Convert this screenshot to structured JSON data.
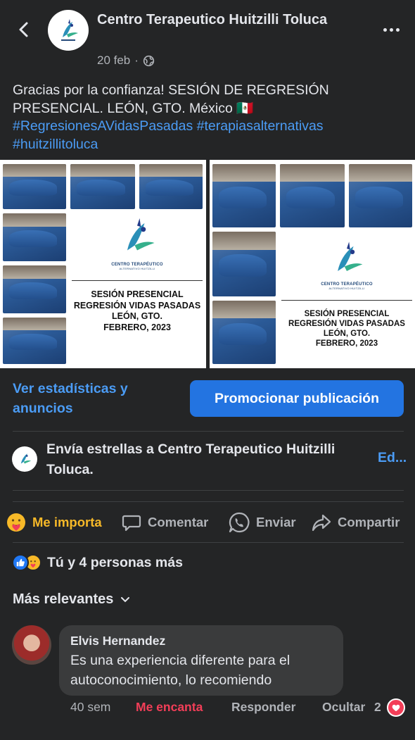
{
  "header": {
    "page_name": "Centro Terapeutico Huitzilli Toluca",
    "date": "20 feb",
    "separator": "·",
    "audience_icon": "globe-icon"
  },
  "post": {
    "caption_text": "Gracias por la confianza! SESIÓN DE REGRESIÓN PRESENCIAL. LEÓN, GTO. México 🇲🇽",
    "hashtags": [
      "#RegresionesAVidasPasadas",
      "#terapiasalternativas",
      "#huitzillitoluca"
    ],
    "images": [
      {
        "logo_text": "CENTRO TERAPÉUTICO",
        "logo_subtext": "ALTERNATIVO HUITZILLI",
        "line1": "SESIÓN PRESENCIAL",
        "line2": "REGRESIÓN VIDAS PASADAS",
        "line3": "LEÓN, GTO.",
        "line4": "FEBRERO, 2023"
      },
      {
        "logo_text": "CENTRO TERAPÉUTICO",
        "logo_subtext": "ALTERNATIVO HUITZILLI",
        "line1": "SESIÓN PRESENCIAL",
        "line2": "REGRESIÓN VIDAS PASADAS",
        "line3": "LEÓN, GTO.",
        "line4": "FEBRERO, 2023"
      }
    ]
  },
  "insights": {
    "stats_link": "Ver estadísticas y anuncios",
    "promote_button": "Promocionar publicación"
  },
  "stars": {
    "text": "Envía estrellas a Centro Terapeutico Huitzilli Toluca.",
    "edit_link": "Ed..."
  },
  "actions": {
    "like": "Me importa",
    "comment": "Comentar",
    "send": "Enviar",
    "share": "Compartir"
  },
  "reactions": {
    "summary": "Tú y 4 personas más"
  },
  "comments_sort": "Más relevantes",
  "comment": {
    "author": "Elvis Hernandez",
    "text": "Es una experiencia diferente para el autoconocimiento, lo recomiendo",
    "time": "40 sem",
    "reaction_label": "Me encanta",
    "reply": "Responder",
    "hide": "Ocultar",
    "reaction_count": "2"
  },
  "colors": {
    "background": "#242526",
    "link_blue": "#4b9cf5",
    "button_blue": "#2374e1",
    "care_yellow": "#f7b928",
    "love_red": "#f33e58"
  }
}
